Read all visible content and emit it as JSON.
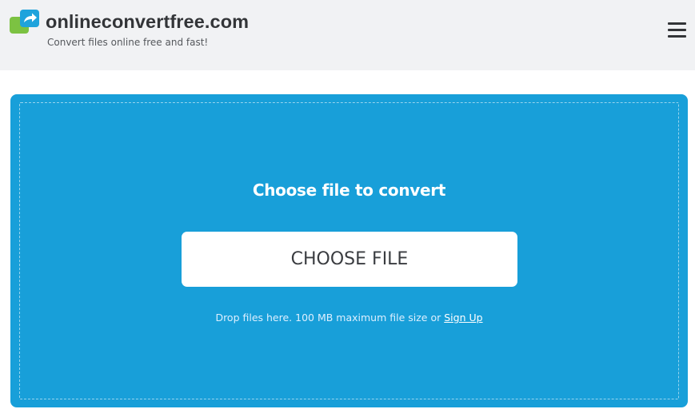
{
  "header": {
    "site_name": "onlineconvertfree.com",
    "tagline": "Convert files online free and fast!",
    "logo_icon": "arrow-convert-icon",
    "menu_icon": "hamburger-menu-icon"
  },
  "upload": {
    "title": "Choose file to convert",
    "button_label": "CHOOSE FILE",
    "drop_note": "Drop files here. 100 MB maximum file size or ",
    "sign_up_label": "Sign Up"
  },
  "colors": {
    "panel_background": "#189fd9",
    "header_background": "#f1f2f4",
    "logo_green": "#7cc242",
    "logo_blue": "#1fa3dc"
  }
}
